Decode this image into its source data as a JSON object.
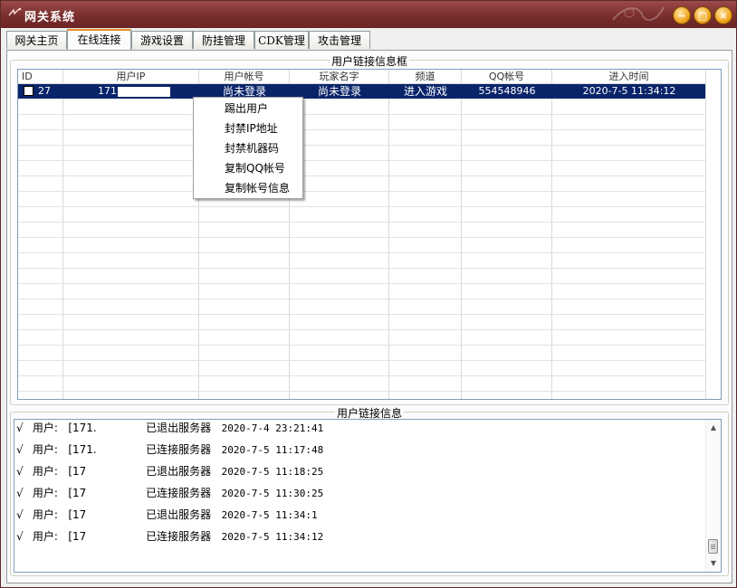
{
  "window": {
    "title": "网关系统",
    "app_icon": "gateway-icon",
    "buttons": {
      "minimize": "−",
      "maximize": "□",
      "close": "×"
    }
  },
  "tabs": [
    {
      "label": "网关主页",
      "active": false
    },
    {
      "label": "在线连接",
      "active": true
    },
    {
      "label": "游戏设置",
      "active": false
    },
    {
      "label": "防挂管理",
      "active": false
    },
    {
      "label": "CDK管理",
      "active": false
    },
    {
      "label": "攻击管理",
      "active": false
    }
  ],
  "connections": {
    "group_title": "用户链接信息框",
    "columns": [
      "ID",
      "用户IP",
      "用户帐号",
      "玩家名字",
      "频道",
      "QQ帐号",
      "进入时间"
    ],
    "rows": [
      {
        "id": "27",
        "ip": "171.",
        "account": "尚未登录",
        "player": "尚未登录",
        "channel": "进入游戏",
        "qq": "554548946",
        "time": "2020-7-5 11:34:12",
        "selected": true
      }
    ]
  },
  "context_menu": {
    "items": [
      "踢出用户",
      "封禁IP地址",
      "封禁机器码",
      "复制QQ帐号",
      "复制帐号信息"
    ]
  },
  "log": {
    "group_title": "用户链接信息",
    "lines": [
      {
        "check": "√",
        "label": "用户:",
        "ip": "[171.",
        "msg": "已退出服务器",
        "time": "2020-7-4 23:21:41"
      },
      {
        "check": "√",
        "label": "用户:",
        "ip": "[171.",
        "msg": "已连接服务器",
        "time": "2020-7-5 11:17:48"
      },
      {
        "check": "√",
        "label": "用户:",
        "ip": "[17",
        "msg": "已退出服务器",
        "time": "2020-7-5 11:18:25"
      },
      {
        "check": "√",
        "label": "用户:",
        "ip": "[17",
        "msg": "已连接服务器",
        "time": "2020-7-5 11:30:25"
      },
      {
        "check": "√",
        "label": "用户:",
        "ip": "[17",
        "msg": "已退出服务器",
        "time": "2020-7-5 11:34:1"
      },
      {
        "check": "√",
        "label": "用户:",
        "ip": "[17",
        "msg": "已连接服务器",
        "time": "2020-7-5 11:34:12"
      }
    ]
  },
  "colors": {
    "titlebar": "#7a2e2e",
    "selection": "#0a246a",
    "tab_accent": "#e68b2c"
  }
}
